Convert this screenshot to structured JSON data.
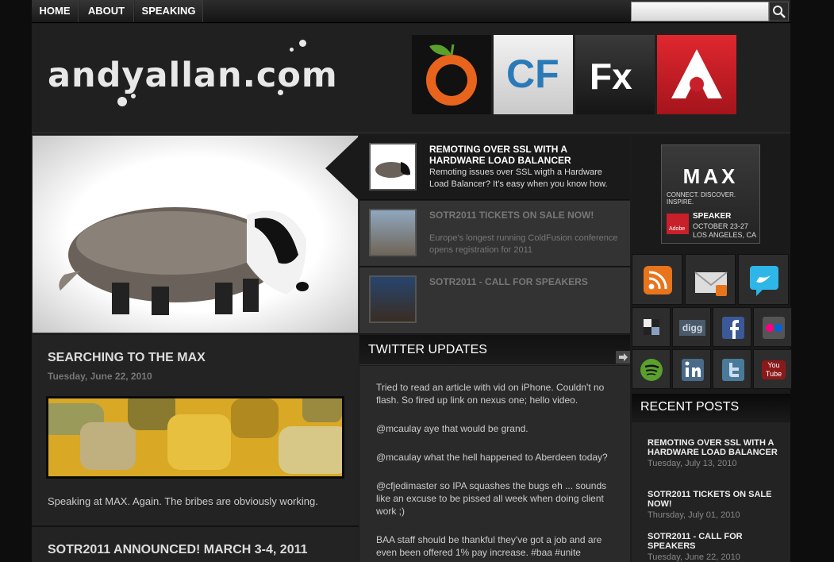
{
  "nav": {
    "items": [
      "HOME",
      "ABOUT",
      "SPEAKING"
    ]
  },
  "search": {
    "placeholder": ""
  },
  "header": {
    "logo_text": "andyallan.com",
    "logos": [
      {
        "name": "orange-logo",
        "bg": "#111111"
      },
      {
        "name": "CF",
        "bg": "#dcdcdc"
      },
      {
        "name": "Fx",
        "bg": "#2a2a2a"
      },
      {
        "name": "air-logo",
        "bg": "#c8202a"
      }
    ]
  },
  "features": [
    {
      "title": "REMOTING OVER SSL WITH A HARDWARE LOAD BALANCER",
      "desc": "Remoting issues over SSL wigth a Hardware Load Balancer? It's easy when you know how."
    },
    {
      "title": "SOTR2011 TICKETS ON SALE NOW!",
      "desc": "Europe's longest running ColdFusion conference opens registration for 2011"
    },
    {
      "title": "SOTR2011 - CALL FOR SPEAKERS",
      "desc": ""
    }
  ],
  "posts": [
    {
      "title": "SEARCHING TO THE MAX",
      "date": "Tuesday, June 22, 2010",
      "text": "Speaking at MAX. Again. The bribes are obviously working."
    },
    {
      "title": "SOTR2011 ANNOUNCED! MARCH 3-4, 2011"
    }
  ],
  "twitter": {
    "heading": "TWITTER UPDATES",
    "tweets": [
      "Tried to read an article with vid on iPhone. Couldn't no flash. So fired up link on nexus one; hello video.",
      "@mcaulay aye that would be grand.",
      "@mcaulay what the hell happened to Aberdeen today?",
      "@cfjedimaster so IPA squashes the bugs eh ... sounds like an excuse to be pissed all week when doing client work ;)",
      "BAA staff should be thankful they've got a job and are even been offered 1% pay increase. #baa #unite"
    ]
  },
  "max_badge": {
    "logo": "MAX",
    "tagline": "CONNECT. DISCOVER. INSPIRE.",
    "role": "SPEAKER",
    "dates": "OCTOBER 23-27",
    "city": "LOS ANGELES, CA",
    "brand": "Adobe"
  },
  "social": {
    "big": [
      "rss",
      "email",
      "twitter"
    ],
    "small_labels": {
      "digg": "digg",
      "youtube": "You Tube"
    }
  },
  "recent": {
    "heading": "RECENT POSTS",
    "items": [
      {
        "title": "REMOTING OVER SSL WITH A HARDWARE LOAD BALANCER",
        "date": "Tuesday, July 13, 2010"
      },
      {
        "title": "SOTR2011 TICKETS ON SALE NOW!",
        "date": "Thursday, July 01, 2010"
      },
      {
        "title": "SOTR2011 - CALL FOR SPEAKERS",
        "date": "Tuesday, June 22, 2010"
      }
    ]
  },
  "colors": {
    "accent_red": "#c8202a",
    "rss_orange": "#e8741c",
    "twitter_blue": "#2fb6e8"
  }
}
